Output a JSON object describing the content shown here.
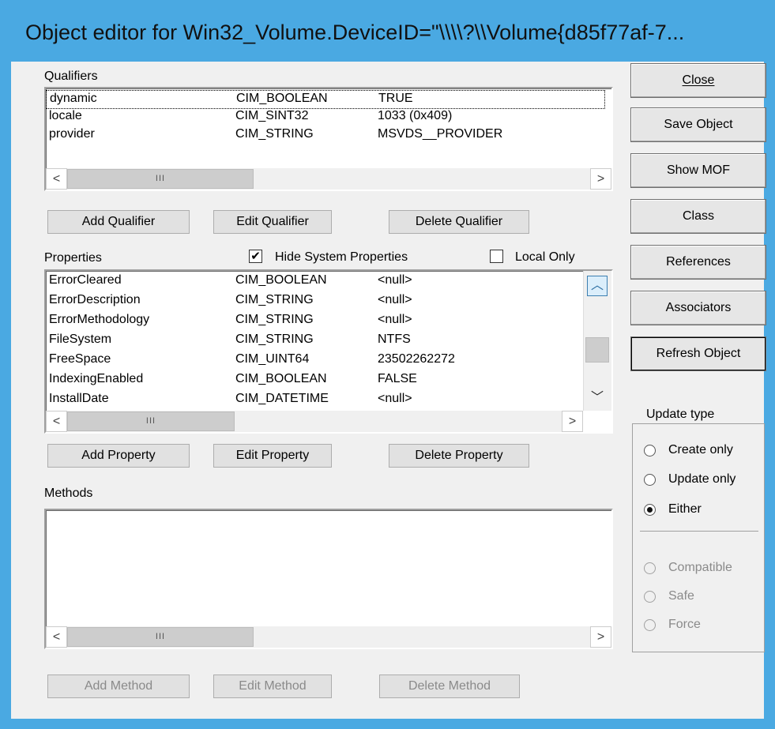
{
  "window": {
    "title": "Object editor for Win32_Volume.DeviceID=\"\\\\\\\\?\\\\Volume{d85f77af-7..."
  },
  "qualifiers": {
    "label": "Qualifiers",
    "rows": [
      {
        "name": "dynamic",
        "type": "CIM_BOOLEAN",
        "value": "TRUE"
      },
      {
        "name": "locale",
        "type": "CIM_SINT32",
        "value": "1033 (0x409)"
      },
      {
        "name": "provider",
        "type": "CIM_STRING",
        "value": "MSVDS__PROVIDER"
      }
    ],
    "add": "Add Qualifier",
    "edit": "Edit Qualifier",
    "delete": "Delete Qualifier"
  },
  "properties": {
    "label": "Properties",
    "hide_system": "Hide System Properties",
    "hide_system_checked": true,
    "local_only": "Local Only",
    "local_only_checked": false,
    "rows": [
      {
        "name": "ErrorCleared",
        "type": "CIM_BOOLEAN",
        "value": "<null>"
      },
      {
        "name": "ErrorDescription",
        "type": "CIM_STRING",
        "value": "<null>"
      },
      {
        "name": "ErrorMethodology",
        "type": "CIM_STRING",
        "value": "<null>"
      },
      {
        "name": "FileSystem",
        "type": "CIM_STRING",
        "value": "NTFS"
      },
      {
        "name": "FreeSpace",
        "type": "CIM_UINT64",
        "value": "23502262272"
      },
      {
        "name": "IndexingEnabled",
        "type": "CIM_BOOLEAN",
        "value": "FALSE"
      },
      {
        "name": "InstallDate",
        "type": "CIM_DATETIME",
        "value": "<null>"
      }
    ],
    "add": "Add Property",
    "edit": "Edit Property",
    "delete": "Delete Property"
  },
  "methods": {
    "label": "Methods",
    "add": "Add Method",
    "edit": "Edit Method",
    "delete": "Delete Method"
  },
  "sidebar": {
    "close": "Close",
    "save": "Save Object",
    "show_mof": "Show MOF",
    "class": "Class",
    "references": "References",
    "associators": "Associators",
    "refresh": "Refresh Object"
  },
  "update_type": {
    "label": "Update type",
    "options": [
      "Create only",
      "Update only",
      "Either"
    ],
    "selected": "Either",
    "modes": [
      "Compatible",
      "Safe",
      "Force"
    ]
  },
  "scroll": {
    "left": "<",
    "right": ">",
    "up": "^",
    "down": "v",
    "grip": "III"
  }
}
